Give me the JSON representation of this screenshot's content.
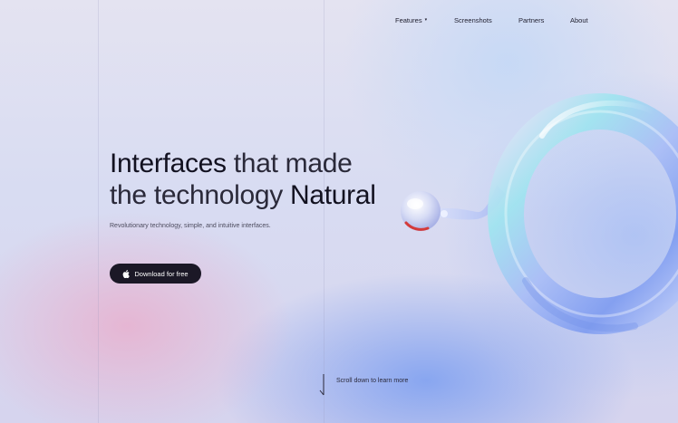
{
  "nav": {
    "items": [
      {
        "label": "Features",
        "has_caret": true
      },
      {
        "label": "Screenshots"
      },
      {
        "label": "Partners"
      },
      {
        "label": "About"
      }
    ],
    "caret_glyph": "▾"
  },
  "hero": {
    "title_part1": "Interfaces",
    "title_part2": " that made",
    "title_part3": "the technology ",
    "title_part4": "Natural",
    "subtitle": "Revolutionary technology, simple, and intuitive interfaces."
  },
  "cta": {
    "label": "Download for free",
    "icon": "apple-icon"
  },
  "scroll": {
    "label": "Scroll down to learn more",
    "icon": "arrow-down-icon"
  },
  "colors": {
    "button_bg": "#1b1826",
    "text_dark": "#1d1c2c",
    "ring_blue": "#8fb0f5",
    "ring_cyan": "#a8e8f0",
    "drop_red": "#d43a3a"
  }
}
